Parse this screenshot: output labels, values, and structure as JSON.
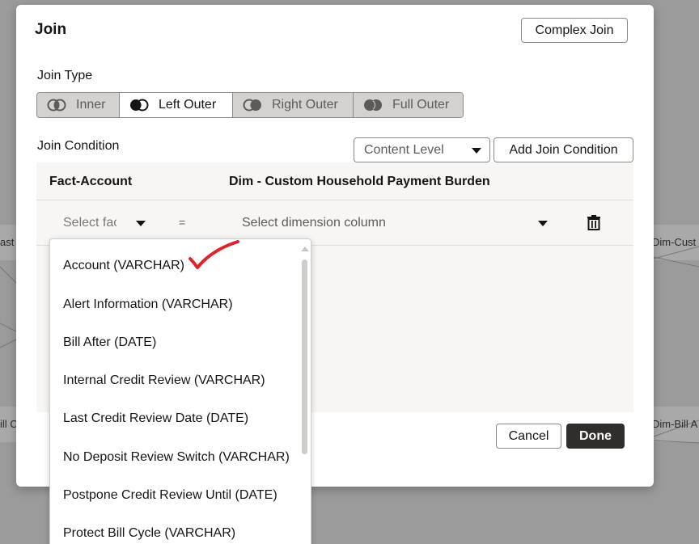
{
  "background": {
    "nodes": [
      "ast",
      "Dim-Cust",
      "ill C",
      "Dim-Bill A"
    ]
  },
  "dialog": {
    "title": "Join",
    "complex_join_label": "Complex Join",
    "join_type_label": "Join Type",
    "join_types": [
      {
        "label": "Inner",
        "selected": false
      },
      {
        "label": "Left Outer",
        "selected": true
      },
      {
        "label": "Right Outer",
        "selected": false
      },
      {
        "label": "Full Outer",
        "selected": false
      }
    ],
    "join_condition_label": "Join Condition",
    "content_level": "Content Level",
    "add_join_condition_label": "Add Join Condition",
    "fact_header": "Fact-Account",
    "dim_header": "Dim - Custom Household Payment Burden",
    "fact_placeholder": "Select fact column",
    "equals": "=",
    "dim_placeholder": "Select dimension column",
    "cancel_label": "Cancel",
    "done_label": "Done"
  },
  "dropdown": {
    "items": [
      "Account (VARCHAR)",
      "Alert Information (VARCHAR)",
      "Bill After (DATE)",
      "Internal Credit Review (VARCHAR)",
      "Last Credit Review Date (DATE)",
      "No Deposit Review Switch (VARCHAR)",
      "Postpone Credit Review Until (DATE)",
      "Protect Bill Cycle (VARCHAR)"
    ]
  },
  "colors": {
    "annotation_check": "#e0222a",
    "primary_button": "#312d2a",
    "selected_segment": "#ffffff",
    "unselected_segment": "#d4d2cf"
  }
}
